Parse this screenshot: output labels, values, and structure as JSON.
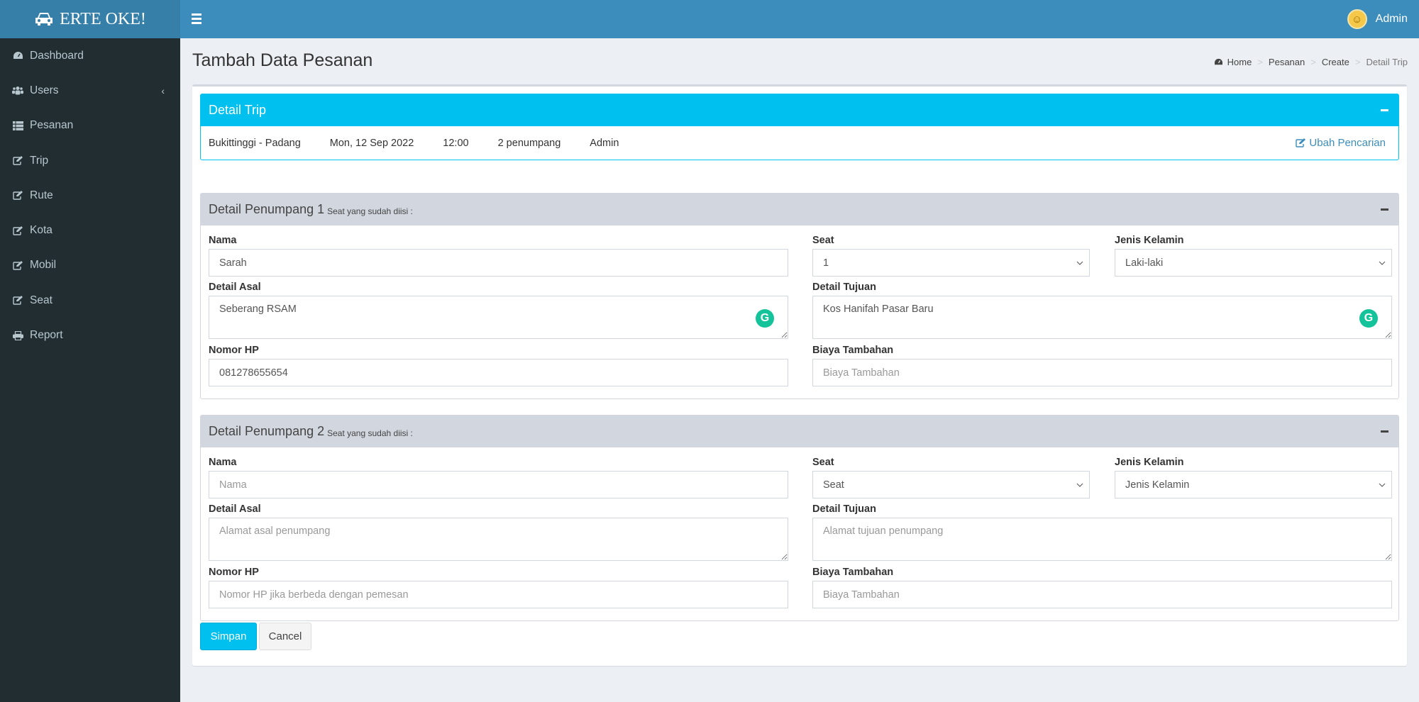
{
  "app": {
    "logo_text": "ERTE OKE!",
    "user_name": "Admin"
  },
  "sidebar": {
    "items": [
      {
        "label": "Dashboard",
        "icon": "dashboard-icon"
      },
      {
        "label": "Users",
        "icon": "users-icon",
        "has_submenu": true
      },
      {
        "label": "Pesanan",
        "icon": "list-icon"
      },
      {
        "label": "Trip",
        "icon": "edit-icon"
      },
      {
        "label": "Rute",
        "icon": "edit-icon"
      },
      {
        "label": "Kota",
        "icon": "edit-icon"
      },
      {
        "label": "Mobil",
        "icon": "edit-icon"
      },
      {
        "label": "Seat",
        "icon": "edit-icon"
      },
      {
        "label": "Report",
        "icon": "print-icon"
      }
    ]
  },
  "page": {
    "title": "Tambah Data Pesanan",
    "breadcrumb": [
      "Home",
      "Pesanan",
      "Create",
      "Detail Trip"
    ]
  },
  "trip": {
    "title": "Detail Trip",
    "route": "Bukittinggi - Padang",
    "date": "Mon, 12 Sep 2022",
    "time": "12:00",
    "passengers": "2 penumpang",
    "admin": "Admin",
    "change_link": "Ubah Pencarian"
  },
  "labels": {
    "nama": "Nama",
    "seat": "Seat",
    "jenis_kelamin": "Jenis Kelamin",
    "detail_asal": "Detail Asal",
    "detail_tujuan": "Detail Tujuan",
    "nomor_hp": "Nomor HP",
    "biaya_tambahan": "Biaya Tambahan",
    "seat_filled": "Seat yang sudah diisi :"
  },
  "placeholders": {
    "nama": "Nama",
    "asal": "Alamat asal penumpang",
    "tujuan": "Alamat tujuan penumpang",
    "hp": "Nomor HP jika berbeda dengan pemesan",
    "biaya": "Biaya Tambahan"
  },
  "passengers": [
    {
      "title": "Detail Penumpang 1",
      "nama": "Sarah",
      "seat": "1",
      "jenis_kelamin": "Laki-laki",
      "asal": "Seberang RSAM",
      "tujuan": "Kos Hanifah Pasar Baru",
      "hp": "081278655654",
      "biaya": ""
    },
    {
      "title": "Detail Penumpang 2",
      "nama": "",
      "seat": "Seat",
      "jenis_kelamin": "Jenis Kelamin",
      "asal": "",
      "tujuan": "",
      "hp": "",
      "biaya": ""
    }
  ],
  "buttons": {
    "save": "Simpan",
    "cancel": "Cancel"
  }
}
